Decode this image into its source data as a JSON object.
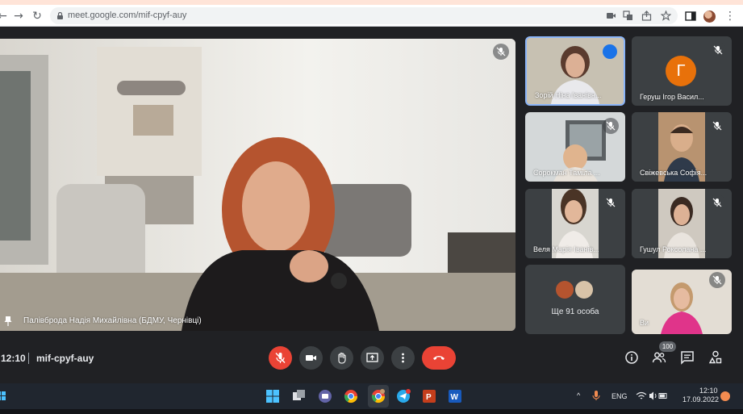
{
  "browser": {
    "url": "meet.google.com/mif-cpyf-auy",
    "profile_initials": ""
  },
  "main_speaker": {
    "name": "Палівброда Надія Михайлівна (БДМУ, Чернівці)",
    "muted": true
  },
  "participants": [
    {
      "name": "Зорій Ніна Іванівн...",
      "speaking": true,
      "muted": false,
      "bg": "#b9b09a"
    },
    {
      "name": "Геруш Ігор Васил...",
      "muted": true,
      "avatar_letter": "Г",
      "bg": "#3c4043"
    },
    {
      "name": "Сорокман Таміла ...",
      "muted": true,
      "bg": "#cfd4d6"
    },
    {
      "name": "Свіжевська Софія...",
      "muted": true,
      "bg": "#b79a7a"
    },
    {
      "name": "Веля Марія Іванів...",
      "muted": true,
      "bg": "#d6d4cf"
    },
    {
      "name": "Гушул Роксолана ...",
      "muted": true,
      "bg": "#c9c4bc"
    },
    {
      "name": "Ви",
      "muted": true,
      "bg": "#d8cfc4"
    }
  ],
  "more_tile": {
    "label": "Ще 91 особа"
  },
  "meeting": {
    "time": "12:10",
    "code": "mif-cpyf-auy",
    "participants_count": "100"
  },
  "taskbar": {
    "lang": "ENG",
    "time": "12:10",
    "date": "17.09.2022"
  },
  "colors": {
    "meet_bg": "#202124",
    "control_bg": "#3c4043",
    "danger": "#ea4335",
    "active_border": "#8ab4f8",
    "avatar_orange": "#e8710a"
  }
}
